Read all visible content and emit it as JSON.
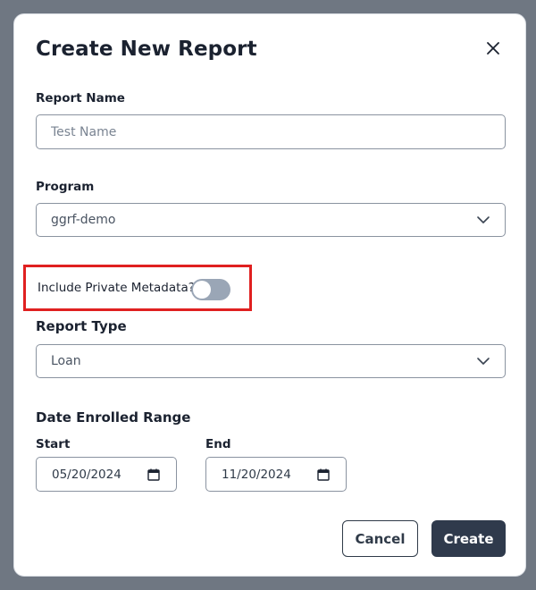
{
  "modal": {
    "title": "Create New Report",
    "close_icon": "close-icon"
  },
  "report_name": {
    "label": "Report Name",
    "placeholder": "Test Name",
    "value": ""
  },
  "program": {
    "label": "Program",
    "selected": "ggrf-demo",
    "icon": "chevron-down-icon"
  },
  "private_metadata": {
    "label": "Include Private Metadata?",
    "enabled": false,
    "highlight_color": "#e02020"
  },
  "report_type": {
    "label": "Report Type",
    "selected": "Loan",
    "icon": "chevron-down-icon"
  },
  "date_range": {
    "label": "Date Enrolled Range",
    "start_label": "Start",
    "start_value": "05/20/2024",
    "end_label": "End",
    "end_value": "11/20/2024",
    "icon": "calendar-icon"
  },
  "actions": {
    "cancel_label": "Cancel",
    "create_label": "Create",
    "primary_color": "#2f3a4c"
  }
}
